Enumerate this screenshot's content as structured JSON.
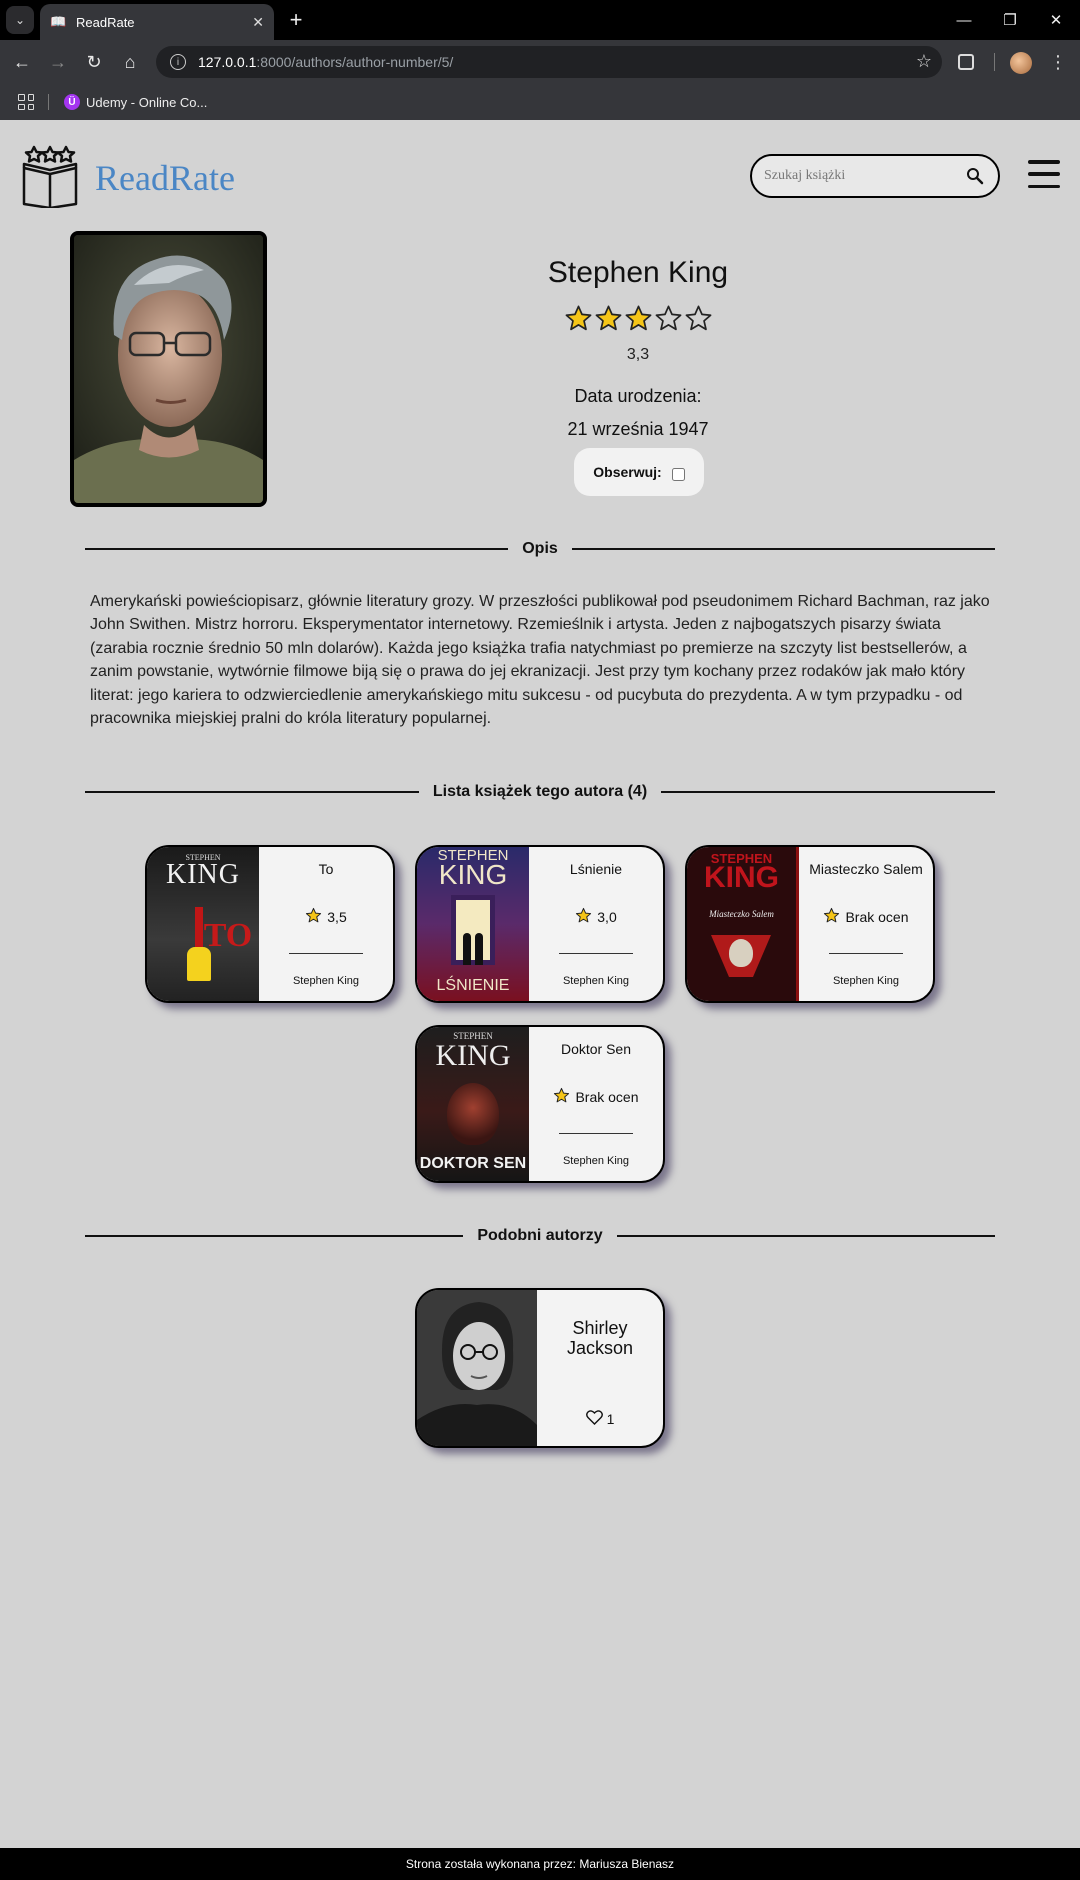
{
  "browser": {
    "tab_title": "ReadRate",
    "url_host": "127.0.0.1",
    "url_path": ":8000/authors/author-number/5/",
    "bookmark_label": "Udemy - Online Co..."
  },
  "site": {
    "brand": "ReadRate",
    "search_placeholder": "Szukaj książki"
  },
  "author": {
    "name": "Stephen King",
    "rating_stars": 3,
    "rating_max": 5,
    "rating_value": "3,3",
    "birth_label": "Data urodzenia:",
    "birth_date": "21 września 1947",
    "follow_label": "Obserwuj:"
  },
  "sections": {
    "description_title": "Opis",
    "books_title": "Lista książek tego autora (4)",
    "similar_title": "Podobni autorzy"
  },
  "description": "Amerykański powieściopisarz, głównie literatury grozy. W przeszłości publikował pod pseudonimem Richard Bachman, raz jako John Swithen. Mistrz horroru. Eksperymentator internetowy. Rzemieślnik i artysta. Jeden z najbogatszych pisarzy świata (zarabia rocznie średnio 50 mln dolarów). Każda jego książka trafia natychmiast po premierze na szczyty list bestsellerów, a zanim powstanie, wytwórnie filmowe biją się o prawa do jej ekranizacji. Jest przy tym kochany przez rodaków jak mało który literat: jego kariera to odzwierciedlenie amerykańskiego mitu sukcesu - od pucybuta do prezydenta. A w tym przypadku - od pracownika miejskiej pralni do króla literatury popularnej.",
  "books": [
    {
      "title": "To",
      "rating": "3,5",
      "author": "Stephen King",
      "cover_top": "STEPHEN",
      "cover_brand": "KING",
      "cover_title": "TO"
    },
    {
      "title": "Lśnienie",
      "rating": "3,0",
      "author": "Stephen King",
      "cover_top": "STEPHEN",
      "cover_brand": "KING",
      "cover_title": "LŚNIENIE"
    },
    {
      "title": "Miasteczko Salem",
      "rating": "Brak ocen",
      "author": "Stephen King",
      "cover_top": "STEPHEN",
      "cover_brand": "KING",
      "cover_title": "Miasteczko Salem"
    },
    {
      "title": "Doktor Sen",
      "rating": "Brak ocen",
      "author": "Stephen King",
      "cover_top": "STEPHEN",
      "cover_brand": "KING",
      "cover_title": "DOKTOR SEN"
    }
  ],
  "similar_authors": [
    {
      "name": "Shirley Jackson",
      "likes": "1"
    }
  ],
  "footer": "Strona została wykonana przez: Mariusza Bienasz",
  "colors": {
    "brand": "#4a86c5",
    "page_bg": "#d3d3d3",
    "star_fill": "#f5c518"
  }
}
